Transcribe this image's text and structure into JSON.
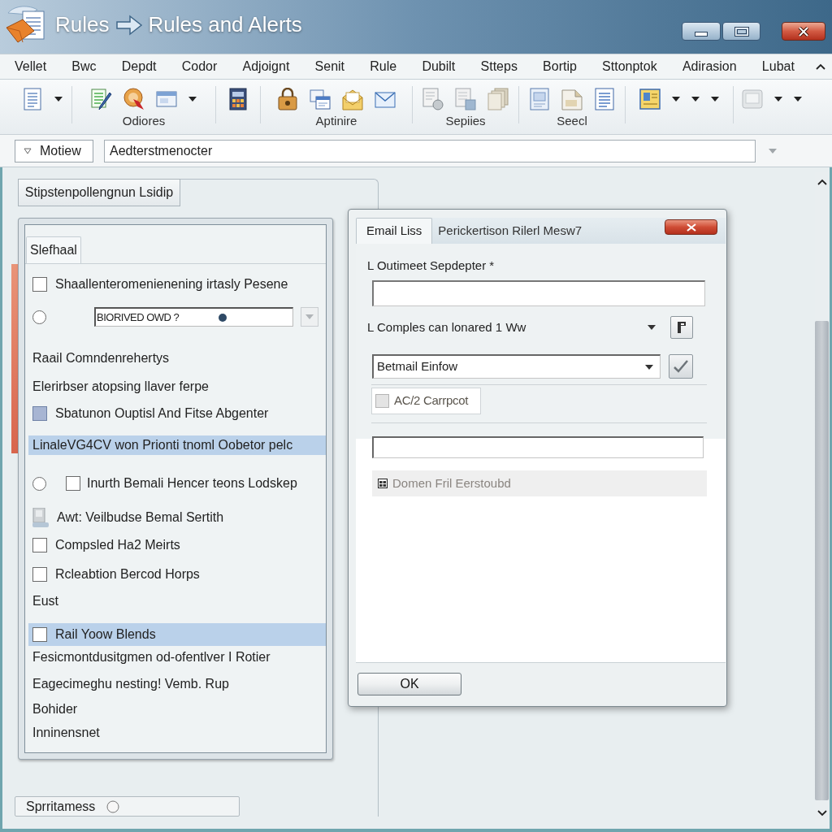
{
  "window": {
    "app_label": "Rules",
    "title": "Rules and Alerts"
  },
  "menu": [
    "Vellet",
    "Bwc",
    "Depdt",
    "Codor",
    "Adjoignt",
    "Senit",
    "Rule",
    "Dubilt",
    "Stteps",
    "Bortip",
    "Sttonptok",
    "Adirasion",
    "Lubat"
  ],
  "toolbar_captions": [
    "Odiores",
    "Aptinire",
    "Sepiies",
    "Seecl"
  ],
  "address_bar": {
    "view_button": "Motiew",
    "value": "Aedterstmenocter"
  },
  "left_pane": {
    "header_button": "Stipstenpollengnun Lsidip",
    "tab": {
      "label": "Slefhaal",
      "selected": true
    },
    "items": [
      {
        "kind": "checkbox",
        "label": "Shaallenteromenienening irtasly Pesene",
        "checked": false,
        "selected": false
      },
      {
        "kind": "radio_combo",
        "value": "BIORIVED OWD ?",
        "checked": false,
        "selected": false
      },
      {
        "kind": "text",
        "label": "Raail Comndenrehertys",
        "selected": false
      },
      {
        "kind": "text",
        "label": "Elerirbser atopsing llaver ferpe",
        "selected": false
      },
      {
        "kind": "checkbox",
        "label": "Sbatunon Ouptisl And Fitse Abgenter",
        "checked": true,
        "selected": false
      },
      {
        "kind": "text",
        "label": "LinaleVG4CV won Prionti tnoml Oobetor pelc",
        "selected": true
      },
      {
        "kind": "radio_checkbox",
        "label": "Inurth Bemali Hencer teons Lodskep",
        "radio_checked": false,
        "checked": false,
        "selected": false
      },
      {
        "kind": "icon",
        "label": "Awt: Veilbudse Bemal Sertith",
        "selected": false
      },
      {
        "kind": "checkbox",
        "label": "Compsled Ha2 Meirts",
        "checked": false,
        "selected": false
      },
      {
        "kind": "checkbox",
        "label": "Rcleabtion Bercod Horps",
        "checked": false,
        "selected": false
      },
      {
        "kind": "text",
        "label": "Eust",
        "selected": false
      },
      {
        "kind": "checkbox",
        "label": "Rail Yoow Blends",
        "checked": false,
        "selected": true
      },
      {
        "kind": "text",
        "label": "Fesicmontdusitgmen od-ofentlver I Rotier",
        "selected": false
      },
      {
        "kind": "text",
        "label": "Eagecimeghu nesting! Vemb. Rup",
        "selected": false
      },
      {
        "kind": "text",
        "label": "Bohider",
        "selected": false
      },
      {
        "kind": "text",
        "label": "Inninensnet",
        "selected": false
      }
    ],
    "footer_button": "Sprritamess"
  },
  "dialog": {
    "tabs": [
      {
        "label": "Email Liss",
        "selected": true
      },
      {
        "label": "Perickertison Rilerl Mesw7",
        "selected": false
      }
    ],
    "field_label": "L Outimeet Sepdepter *",
    "combo_label": "L Comples can lonared 1 Ww",
    "select_value": "Betmail Einfow",
    "option": {
      "label": "AC/2 Carrpcot",
      "checked": false
    },
    "note": "Domen Fril Eerstoubd",
    "ok_button": "OK"
  }
}
